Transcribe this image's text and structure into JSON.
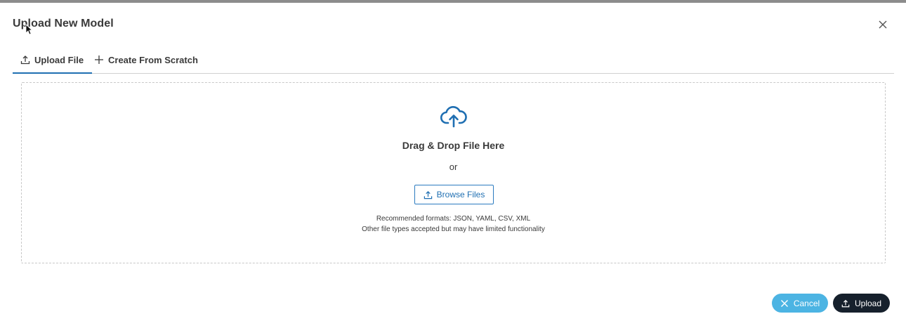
{
  "dialog": {
    "title": "Upload New Model",
    "close_icon": "close-icon"
  },
  "tabs": [
    {
      "label": "Upload File",
      "icon": "upload-icon",
      "active": true
    },
    {
      "label": "Create From Scratch",
      "icon": "plus-icon",
      "active": false
    }
  ],
  "dropzone": {
    "icon": "cloud-upload-icon",
    "title": "Drag & Drop File Here",
    "or_text": "or",
    "browse_label": "Browse Files",
    "hint_formats": "Recommended formats: JSON, YAML, CSV, XML",
    "hint_other": "Other file types accepted but may have limited functionality"
  },
  "footer": {
    "cancel_label": "Cancel",
    "upload_label": "Upload"
  },
  "colors": {
    "accent": "#1f6fb2",
    "cancel_bg": "#4cb4e3",
    "upload_bg": "#16202c",
    "top_bar": "#8c8c8c"
  }
}
